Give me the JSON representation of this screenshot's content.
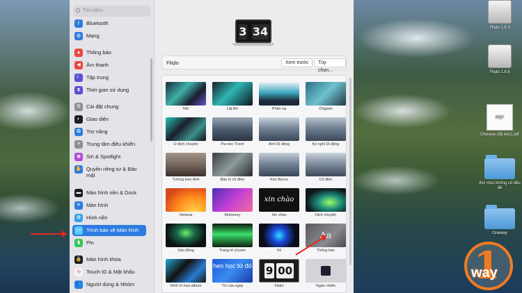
{
  "sidebar": {
    "search_placeholder": "Tìm kiếm",
    "items": [
      {
        "label": "Bluetooth",
        "icon": "bluetooth-icon",
        "color": "#2d7be0",
        "glyph": "ᛒ"
      },
      {
        "label": "Mạng",
        "icon": "globe-icon",
        "color": "#2d7be0",
        "glyph": "◍"
      },
      {
        "label": "Thông báo",
        "icon": "bell-icon",
        "color": "#e9473f",
        "glyph": "▲"
      },
      {
        "label": "Âm thanh",
        "icon": "speaker-icon",
        "color": "#e9473f",
        "glyph": "◀"
      },
      {
        "label": "Tập trung",
        "icon": "moon-icon",
        "color": "#5b4fd6",
        "glyph": "☾"
      },
      {
        "label": "Thời gian sử dụng",
        "icon": "hourglass-icon",
        "color": "#5b4fd6",
        "glyph": "⧗"
      },
      {
        "label": "Cài đặt chung",
        "icon": "gear-icon",
        "color": "#8e8e93",
        "glyph": "⚙"
      },
      {
        "label": "Giao diện",
        "icon": "appearance-icon",
        "color": "#1c1c1e",
        "glyph": "◐"
      },
      {
        "label": "Trợ năng",
        "icon": "accessibility-icon",
        "color": "#2d7be0",
        "glyph": "✪"
      },
      {
        "label": "Trung tâm điều khiển",
        "icon": "control-center-icon",
        "color": "#8e8e93",
        "glyph": "≡"
      },
      {
        "label": "Siri & Spotlight",
        "icon": "siri-icon",
        "color": "#b04ad8",
        "glyph": "◉"
      },
      {
        "label": "Quyền riêng tư & Bảo mật",
        "icon": "hand-icon",
        "color": "#2d7be0",
        "glyph": "✋"
      },
      {
        "label": "Màn hình nền & Dock",
        "icon": "dock-icon",
        "color": "#1c1c1e",
        "glyph": "▬"
      },
      {
        "label": "Màn hình",
        "icon": "sun-icon",
        "color": "#2d7be0",
        "glyph": "☀"
      },
      {
        "label": "Hình nền",
        "icon": "wallpaper-icon",
        "color": "#36a4e8",
        "glyph": "✿"
      },
      {
        "label": "Trình bảo vệ Màn hình",
        "icon": "screensaver-icon",
        "color": "#5ac8fa",
        "glyph": "▭"
      },
      {
        "label": "Pin",
        "icon": "battery-icon",
        "color": "#34c759",
        "glyph": "▮"
      },
      {
        "label": "Màn hình khóa",
        "icon": "lock-icon",
        "color": "#1c1c1e",
        "glyph": "🔒"
      },
      {
        "label": "Touch ID & Mật khẩu",
        "icon": "fingerprint-icon",
        "color": "#f5f5f5",
        "glyph": "◎"
      },
      {
        "label": "Người dùng & Nhóm",
        "icon": "users-icon",
        "color": "#2d7be0",
        "glyph": "👥"
      }
    ]
  },
  "preview": {
    "hour": "3",
    "minute": "34"
  },
  "screensaver_bar": {
    "title": "Fliqlo",
    "preview_button": "Xem trước",
    "options_button": "Tùy chọn..."
  },
  "tiles": [
    {
      "label": "Nổi",
      "bg": "linear-gradient(135deg,#1a2a3a,#3fb0a8 40%,#1a1d2e 70%,#6a5acd)"
    },
    {
      "label": "Lật lên",
      "bg": "linear-gradient(135deg,#17202c,#2fb6b3 45%,#0f1620)"
    },
    {
      "label": "Phản xạ",
      "bg": "linear-gradient(180deg,#eef2f5 0%,#3fa8c0 45%,#1c2a3a 80%)"
    },
    {
      "label": "Origami",
      "bg": "linear-gradient(135deg,#2b6f84,#6fc1cf 50%,#243847)"
    },
    {
      "label": "Ô dịch chuyển",
      "bg": "linear-gradient(135deg,#26c2b8,#1b1f2a 40%,#3e8f8a 70%,#0e1218)"
    },
    {
      "label": "Pa-nen Trượt",
      "bg": "linear-gradient(180deg,#9aa7b3 0%,#4e5d72 50%,#2b3443 100%)"
    },
    {
      "label": "Ảnh Di động",
      "bg": "linear-gradient(180deg,#c9d3dc 0%,#6d7d90 50%,#3b475a 100%)"
    },
    {
      "label": "Ký nghị Di động",
      "bg": "linear-gradient(180deg,#b7c2cc 0%,#6a7a8d 50%,#3d485a 100%)"
    },
    {
      "label": "Tường treo Ảnh",
      "bg": "linear-gradient(180deg,#a4958a 0%,#6c5e55 60%,#3a2f2a 100%)"
    },
    {
      "label": "Bàn in cổ điển",
      "bg": "linear-gradient(135deg,#3a3d40,#8e9a9d 50%,#2a2d30)"
    },
    {
      "label": "Ken Burns",
      "bg": "linear-gradient(180deg,#c5ced7 0%,#6f7f93 50%,#3a4657 100%)"
    },
    {
      "label": "Cổ điển",
      "bg": "linear-gradient(180deg,#c9d2db 0%,#7a889a 50%,#3f4a5b 100%)"
    },
    {
      "label": "Ventura",
      "bg": "radial-gradient(ellipse at 70% 100%,#ffd34a,#ff8a1c 45%,#d8471a 80%)"
    },
    {
      "label": "Monterey",
      "bg": "linear-gradient(135deg,#4a2fb4,#c23fd6 50%,#f06c9a)"
    },
    {
      "label": "Xin chào",
      "bg": "#111111"
    },
    {
      "label": "Dịch chuyển",
      "bg": "radial-gradient(ellipse at 60% 60%,#9bff6a,#1c8c7a 35%,#10161a 70%)"
    },
    {
      "label": "Xáo động",
      "bg": "radial-gradient(ellipse at 50% 40%,#6af06a,#1c6a4a 30%,#0c1210 70%)"
    },
    {
      "label": "Trang trí d.lượn",
      "bg": "linear-gradient(180deg,#0c1c10,#3adf6a 45%,#0e2210)"
    },
    {
      "label": "Vô",
      "bg": "radial-gradient(circle at 50% 50%,#2ae0ff,#1c48d8 30%,#0a0c1a 70%)"
    },
    {
      "label": "Thông báo",
      "bg": "linear-gradient(135deg,#5a5a5e,#8a8a90 60%,#4a4a4e)"
    },
    {
      "label": "Hình m.họa album",
      "bg": "linear-gradient(135deg,#27a7d8,#111 40%,#2a7ad0 70%,#1a1a1a)"
    },
    {
      "label": "Từ của ngày",
      "bg": "linear-gradient(135deg,#1e5ad8,#3a8af0 50%,#1a3aa8)"
    },
    {
      "label": "Fliqlo",
      "bg": "#1c1c1c"
    },
    {
      "label": "Ngẫu nhiên",
      "bg": "#d4d4d8"
    }
  ],
  "tile_text": {
    "xin_chao": "xin chào",
    "tu_cua_ngay": "hen học từ đó",
    "fliqlo_hour": "9",
    "fliqlo_minute": "00",
    "aa": "Aa"
  },
  "desktop": [
    {
      "label": "Fliqlo 1.9.3",
      "kind": "drive"
    },
    {
      "label": "Fliqlo 1.8.6",
      "kind": "drive"
    },
    {
      "label": "Oneway (đã kéo).pdf",
      "kind": "pdf",
      "badge": "PDF"
    },
    {
      "label": "thư mục không có tiêu đề",
      "kind": "folder"
    },
    {
      "label": "Oneway",
      "kind": "folder"
    }
  ],
  "logo": {
    "digit": "1",
    "text": "way",
    "color": "#f17b22"
  }
}
